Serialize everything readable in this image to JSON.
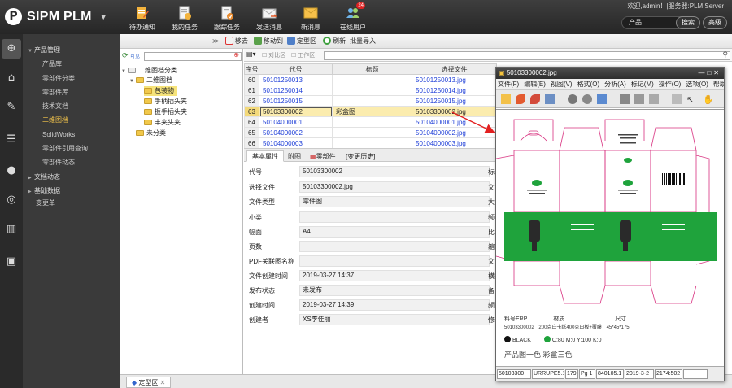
{
  "app": {
    "title": "SIPM PLM",
    "logo_letter": "P",
    "user_info": "欢迎,admin！|服务器:PLM Server"
  },
  "toolbar": {
    "items": [
      {
        "label": "待办通知",
        "icon": "todo-icon"
      },
      {
        "label": "我的任务",
        "icon": "task-icon"
      },
      {
        "label": "跟踪任务",
        "icon": "track-icon"
      },
      {
        "label": "发送消息",
        "icon": "send-mail-icon"
      },
      {
        "label": "新消息",
        "icon": "new-mail-icon"
      },
      {
        "label": "在线用户",
        "icon": "users-icon",
        "badge": "24"
      }
    ],
    "search_scope": "产品",
    "search_label": "搜索",
    "advanced_label": "高级"
  },
  "nav": {
    "items": [
      {
        "label": "产品管理",
        "level": 1,
        "expanded": true
      },
      {
        "label": "产品库",
        "level": 2
      },
      {
        "label": "零部件分类",
        "level": 2
      },
      {
        "label": "零部件库",
        "level": 2
      },
      {
        "label": "技术文档",
        "level": 2
      },
      {
        "label": "二维图档",
        "level": 2,
        "active": true
      },
      {
        "label": "SolidWorks",
        "level": 2
      },
      {
        "label": "零部件引用查询",
        "level": 2
      },
      {
        "label": "零部件动态",
        "level": 2
      },
      {
        "label": "文档动态",
        "level": 1,
        "expanded": false
      },
      {
        "label": "基础数据",
        "level": 1,
        "expanded": false
      },
      {
        "label": "变更单",
        "level": 2
      }
    ]
  },
  "actions": {
    "move_out": "移去",
    "move_to": "移动到",
    "fixed_area": "定型区",
    "refresh": "刷新",
    "batch_import": "批量导入"
  },
  "tree": {
    "tool_text": "可见",
    "nodes": [
      {
        "label": "二维图档分类",
        "indent": 0
      },
      {
        "label": "二维图档",
        "indent": 1
      },
      {
        "label": "包装物",
        "indent": 2,
        "selected": true
      },
      {
        "label": "手柄插头夹",
        "indent": 2
      },
      {
        "label": "扳手插头夹",
        "indent": 2
      },
      {
        "label": "丰夹头夹",
        "indent": 2
      },
      {
        "label": "未分类",
        "indent": 1
      }
    ]
  },
  "grid": {
    "filter_labels": [
      "对比区",
      "工作区"
    ],
    "columns": [
      "序号",
      "代号",
      "标题",
      "选择文件"
    ],
    "rows": [
      {
        "seq": "60",
        "code": "50101250013",
        "title": "",
        "file": "50101250013.jpg"
      },
      {
        "seq": "61",
        "code": "50101250014",
        "title": "",
        "file": "50101250014.jpg"
      },
      {
        "seq": "62",
        "code": "50101250015",
        "title": "",
        "file": "50101250015.jpg"
      },
      {
        "seq": "63",
        "code": "50103300002",
        "title": "彩盒图",
        "file": "50103300002.jpg",
        "selected": true
      },
      {
        "seq": "64",
        "code": "50104000001",
        "title": "",
        "file": "50104000001.jpg"
      },
      {
        "seq": "65",
        "code": "50104000002",
        "title": "",
        "file": "50104000002.jpg"
      },
      {
        "seq": "66",
        "code": "50104000003",
        "title": "",
        "file": "50104000003.jpg"
      }
    ]
  },
  "detail": {
    "tabs": [
      "基本属性",
      "附图",
      "零部件",
      "[变更历史]"
    ],
    "fields": [
      {
        "label": "代号",
        "value": "50103300002"
      },
      {
        "label": "选择文件",
        "value": "50103300002.jpg"
      },
      {
        "label": "文件类型",
        "value": "零件图"
      },
      {
        "label": "小类",
        "value": ""
      },
      {
        "label": "幅面",
        "value": "A4"
      },
      {
        "label": "页数",
        "value": ""
      },
      {
        "label": "PDF关联图名称",
        "value": ""
      },
      {
        "label": "文件创建时间",
        "value": "2019-03-27 14:37"
      },
      {
        "label": "发布状态",
        "value": "未发布"
      },
      {
        "label": "创建时间",
        "value": "2019-03-27 14:39"
      },
      {
        "label": "创建者",
        "value": "XS李佳丽"
      }
    ],
    "right_labels": [
      "标",
      "文",
      "大",
      "频",
      "比",
      "缩",
      "文",
      "横",
      "备",
      "频",
      "修"
    ]
  },
  "bottom": {
    "tab_label": "定型区"
  },
  "viewer": {
    "title": "50103300002.jpg",
    "menu": [
      "文件(F)",
      "编辑(E)",
      "视图(V)",
      "格式(O)",
      "分析(A)",
      "标记(M)",
      "操作(O)",
      "选项(O)",
      "帮助(H)"
    ],
    "drawing": {
      "caption_labels": [
        "料号ERP",
        "材质",
        "尺寸"
      ],
      "caption_values": [
        "50103300002",
        "200克白卡纸400克白板+覆膜",
        "45*45*175"
      ],
      "color_black": "BLACK",
      "color_green": "C:80 M:0 Y:100 K:0",
      "color_green_hex": "#1fa33c",
      "footer": "产品图一色 彩盒三色"
    },
    "status_cells": [
      "50103300",
      "URRUPE5.1",
      "179",
      "Pg 1",
      "840105.1",
      "2019-3-2",
      "2174:502",
      ""
    ]
  }
}
